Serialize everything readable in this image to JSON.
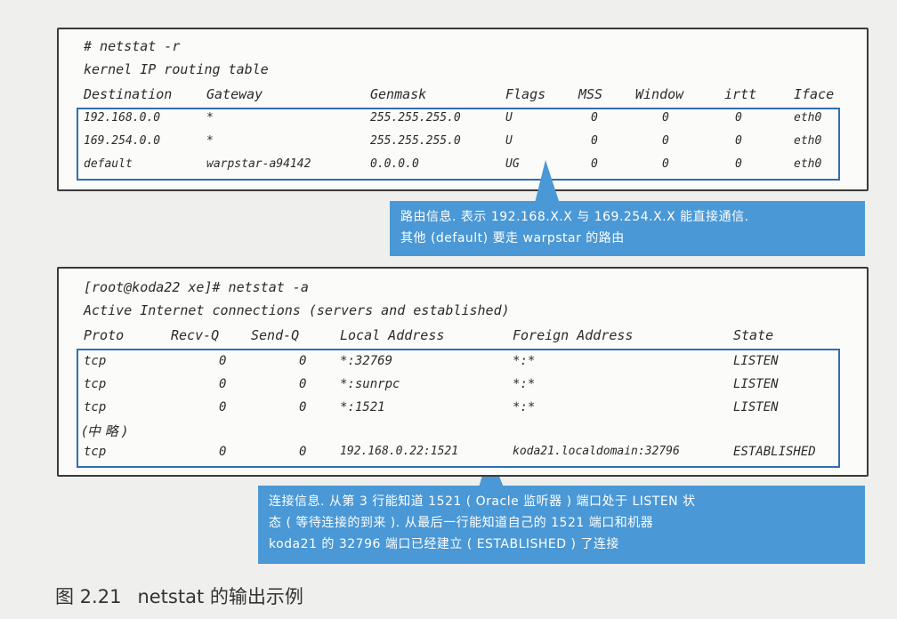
{
  "routing": {
    "command": "# netstat -r",
    "title": "kernel IP routing table",
    "headers": [
      "Destination",
      "Gateway",
      "Genmask",
      "Flags",
      "MSS",
      "Window",
      "irtt",
      "Iface"
    ],
    "rows": [
      [
        "192.168.0.0",
        "*",
        "255.255.255.0",
        "U",
        "0",
        "0",
        "0",
        "eth0"
      ],
      [
        "169.254.0.0",
        "*",
        "255.255.255.0",
        "U",
        "0",
        "0",
        "0",
        "eth0"
      ],
      [
        "default",
        "warpstar-a94142",
        "0.0.0.0",
        "UG",
        "0",
        "0",
        "0",
        "eth0"
      ]
    ]
  },
  "routing_note": {
    "lines": [
      "路由信息. 表示 192.168.X.X 与 169.254.X.X 能直接通信.",
      "其他 (default) 要走 warpstar 的路由"
    ]
  },
  "connections": {
    "command": "[root@koda22 xe]# netstat -a",
    "title": "Active Internet connections (servers and established)",
    "headers": [
      "Proto",
      "Recv-Q",
      "Send-Q",
      "Local Address",
      "Foreign Address",
      "State"
    ],
    "rows": [
      [
        "tcp",
        "0",
        "0",
        "*:32769",
        "*:*",
        "LISTEN"
      ],
      [
        "tcp",
        "0",
        "0",
        "*:sunrpc",
        "*:*",
        "LISTEN"
      ],
      [
        "tcp",
        "0",
        "0",
        "*:1521",
        "*:*",
        "LISTEN"
      ]
    ],
    "omitted": "(中 略 )",
    "last_row": [
      "tcp",
      "0",
      "0",
      "192.168.0.22:1521",
      "koda21.localdomain:32796",
      "ESTABLISHED"
    ]
  },
  "connections_note": {
    "lines": [
      "连接信息. 从第 3 行能知道 1521 ( Oracle 监听器 ) 端口处于 LISTEN 状",
      "态 ( 等待连接的到来 ). 从最后一行能知道自己的 1521 端口和机器",
      "koda21 的 32796 端口已经建立 ( ESTABLISHED ) 了连接"
    ]
  },
  "caption": {
    "number": "图 2.21",
    "text": "netstat 的输出示例"
  },
  "colors": {
    "highlight_border": "#2f6fb4",
    "callout_bg": "#4a98d6"
  }
}
